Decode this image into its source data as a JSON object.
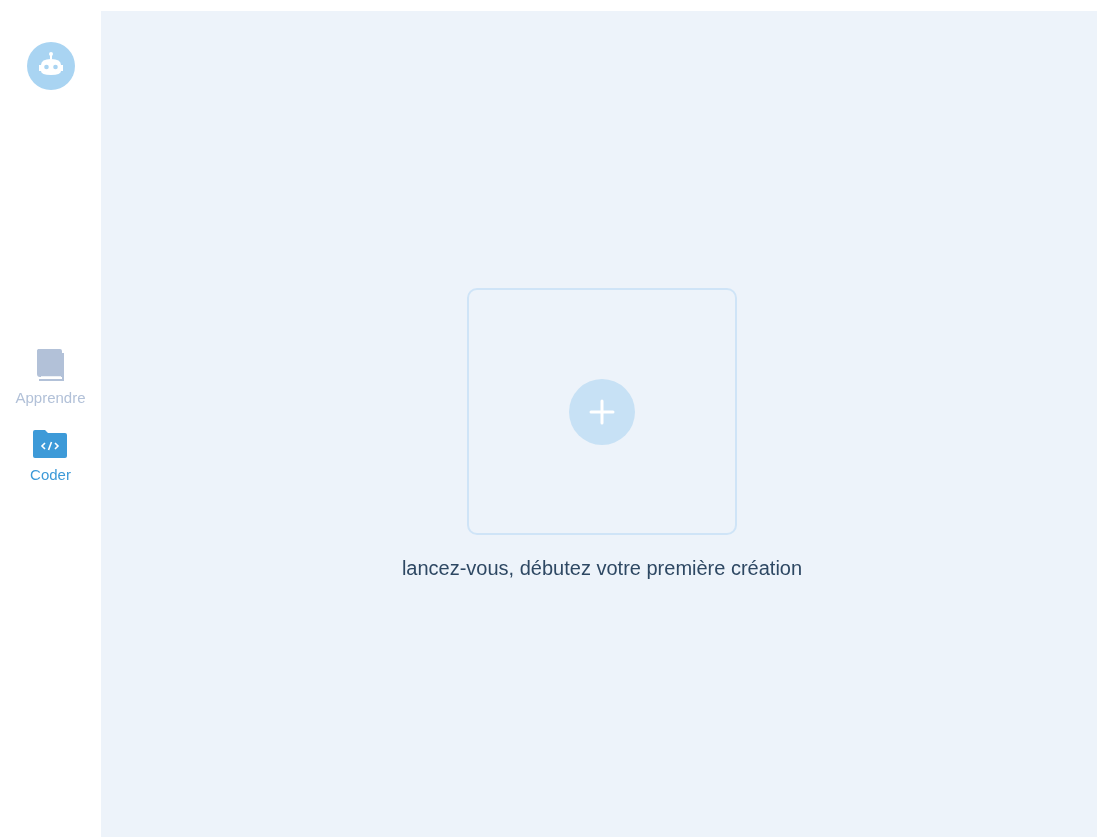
{
  "sidebar": {
    "items": [
      {
        "kind": "book",
        "label": "Apprendre",
        "selected": false
      },
      {
        "kind": "code",
        "label": "Coder",
        "selected": true
      }
    ]
  },
  "empty_state": {
    "message": "lancez-vous, débutez votre première création"
  }
}
